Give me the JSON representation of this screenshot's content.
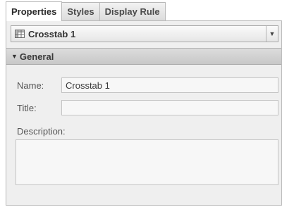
{
  "tabs": [
    {
      "label": "Properties",
      "active": true
    },
    {
      "label": "Styles",
      "active": false
    },
    {
      "label": "Display Rule",
      "active": false
    }
  ],
  "selector": {
    "label": "Crosstab 1",
    "icon": "crosstab-table-icon"
  },
  "section": {
    "label": "General",
    "expanded": true
  },
  "form": {
    "name_label": "Name:",
    "name_value": "Crosstab 1",
    "title_label": "Title:",
    "title_value": "",
    "description_label": "Description:",
    "description_value": ""
  }
}
